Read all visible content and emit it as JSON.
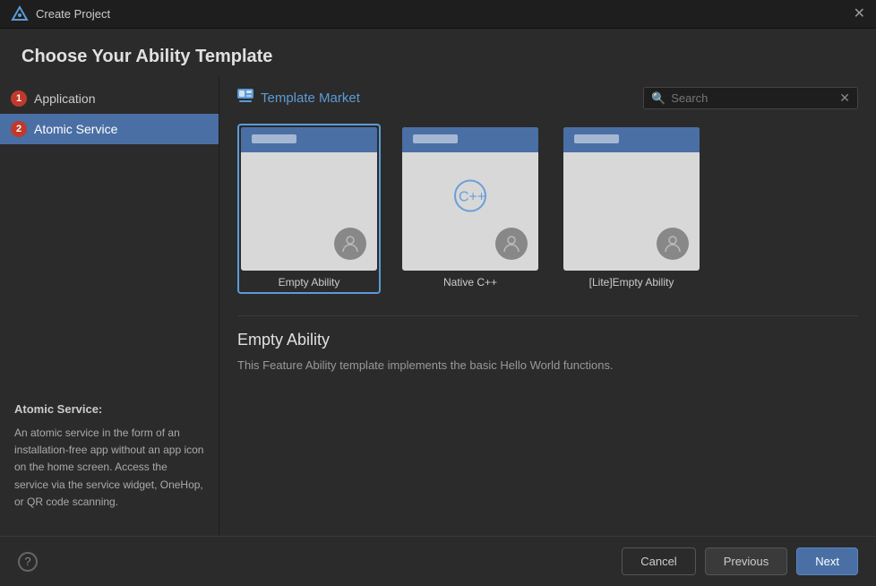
{
  "window": {
    "title": "Create Project",
    "close_label": "✕"
  },
  "header": {
    "title": "Choose Your Ability Template"
  },
  "sidebar": {
    "items": [
      {
        "id": "application",
        "label": "Application",
        "badge": "1",
        "active": false
      },
      {
        "id": "atomic-service",
        "label": "Atomic Service",
        "badge": "2",
        "active": true
      }
    ],
    "description": {
      "title": "Atomic Service:",
      "text": "An atomic service in the form of an installation-free app without an app icon on the home screen. Access the service via the service widget, OneHop, or QR code scanning."
    }
  },
  "panel": {
    "title": "Template Market",
    "title_icon": "🗐",
    "search_placeholder": "Search",
    "search_value": ""
  },
  "templates": [
    {
      "id": "empty-ability",
      "name": "Empty Ability",
      "selected": true,
      "has_center_icon": false
    },
    {
      "id": "native-cpp",
      "name": "Native C++",
      "selected": false,
      "has_center_icon": true,
      "center_text": "C++"
    },
    {
      "id": "lite-empty-ability",
      "name": "[Lite]Empty Ability",
      "selected": false,
      "has_center_icon": false
    }
  ],
  "selected_template": {
    "name": "Empty Ability",
    "description": "This Feature Ability template implements the basic Hello World functions."
  },
  "footer": {
    "help_label": "?",
    "cancel_label": "Cancel",
    "previous_label": "Previous",
    "next_label": "Next"
  }
}
